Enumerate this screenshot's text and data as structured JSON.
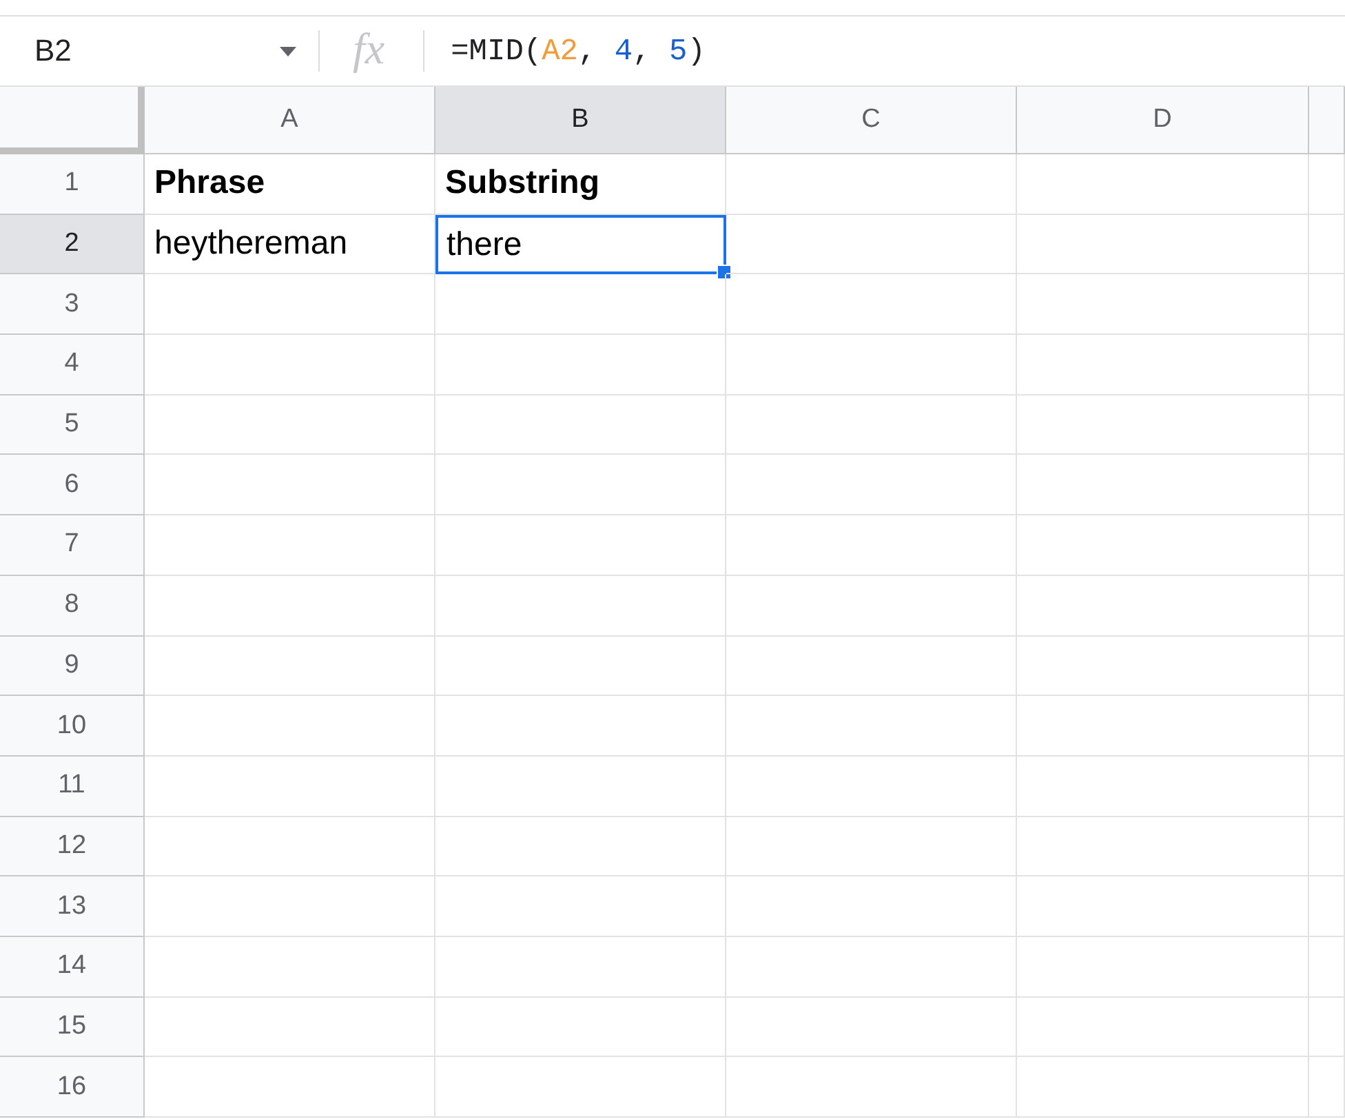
{
  "formula_bar": {
    "name_box": "B2",
    "function_label": "fx",
    "formula": [
      {
        "kind": "text",
        "text": "=MID("
      },
      {
        "kind": "ref",
        "text": "A2"
      },
      {
        "kind": "text",
        "text": ", "
      },
      {
        "kind": "number",
        "text": "4"
      },
      {
        "kind": "text",
        "text": ", "
      },
      {
        "kind": "number",
        "text": "5"
      },
      {
        "kind": "text",
        "text": ")"
      }
    ]
  },
  "columns": [
    {
      "label": "A",
      "selected": false
    },
    {
      "label": "B",
      "selected": true
    },
    {
      "label": "C",
      "selected": false
    },
    {
      "label": "D",
      "selected": false
    }
  ],
  "rows": [
    {
      "number": "1",
      "selected": false,
      "cells": [
        {
          "text": "Phrase",
          "bold": true,
          "selected": false
        },
        {
          "text": "Substring",
          "bold": true,
          "selected": false
        }
      ]
    },
    {
      "number": "2",
      "selected": true,
      "cells": [
        {
          "text": "heythereman",
          "bold": false,
          "selected": false
        },
        {
          "text": "there",
          "bold": false,
          "selected": true
        }
      ]
    },
    {
      "number": "3",
      "selected": false
    },
    {
      "number": "4",
      "selected": false
    },
    {
      "number": "5",
      "selected": false
    },
    {
      "number": "6",
      "selected": false
    },
    {
      "number": "7",
      "selected": false
    },
    {
      "number": "8",
      "selected": false
    },
    {
      "number": "9",
      "selected": false
    },
    {
      "number": "10",
      "selected": false
    },
    {
      "number": "11",
      "selected": false
    },
    {
      "number": "12",
      "selected": false
    },
    {
      "number": "13",
      "selected": false
    },
    {
      "number": "14",
      "selected": false
    },
    {
      "number": "15",
      "selected": false
    },
    {
      "number": "16",
      "selected": false
    }
  ]
}
